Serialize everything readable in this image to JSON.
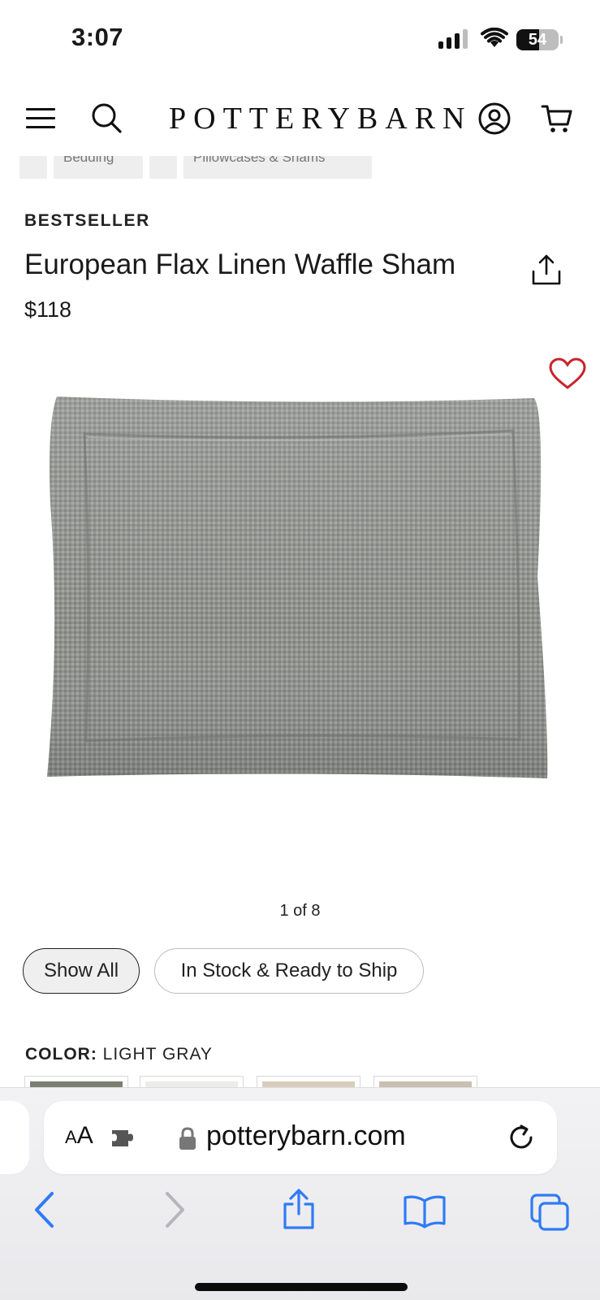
{
  "status_bar": {
    "time": "3:07",
    "battery_percent": "54",
    "battery_level": 0.54,
    "signal_bars_active": 3
  },
  "site_header": {
    "logo": "POTTERYBARN",
    "icons": [
      "menu-icon",
      "search-icon",
      "account-icon",
      "cart-icon"
    ]
  },
  "breadcrumb": {
    "items": [
      "Bedding",
      "Pillowcases & Shams"
    ]
  },
  "product": {
    "badge": "BESTSELLER",
    "title": "European Flax Linen Waffle Sham",
    "price": "$118",
    "image_counter": "1 of 8"
  },
  "filters": {
    "show_all": "Show All",
    "in_stock": "In Stock & Ready to Ship",
    "selected": "Show All"
  },
  "color": {
    "label": "COLOR:",
    "value": "LIGHT GRAY",
    "swatches": [
      "#7b7f72",
      "#ececeb",
      "#d8cdbd",
      "#c9bfb1"
    ]
  },
  "browser": {
    "text_size_label": "AA",
    "url": "potterybarn.com",
    "accent_color": "#2f7bf5"
  }
}
